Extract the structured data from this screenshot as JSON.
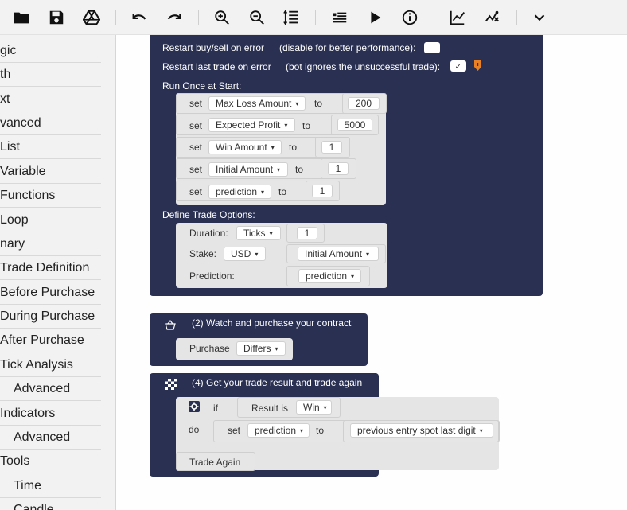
{
  "toolbar": {
    "icons": [
      "folder-open-icon",
      "save-icon",
      "google-drive-icon",
      "undo-icon",
      "redo-icon",
      "zoom-in-icon",
      "zoom-out-icon",
      "sort-icon",
      "list-icon",
      "play-icon",
      "info-icon",
      "chart-icon",
      "trading-view-icon",
      "chevron-down-icon"
    ]
  },
  "sidebar": {
    "items": [
      "gic",
      "th",
      "xt",
      "vanced",
      "List",
      "Variable",
      "Functions",
      "Loop",
      "nary",
      "Trade Definition",
      "Before Purchase",
      "During Purchase",
      "After Purchase",
      "Tick Analysis",
      "Advanced",
      "Indicators",
      "Advanced",
      "Tools",
      "Time",
      "Candle"
    ]
  },
  "trade_params": {
    "restart_on_error": "Restart buy/sell on error",
    "restart_on_error_hint": "(disable for better performance):",
    "restart_last_trade": "Restart last trade on error",
    "restart_last_trade_hint": "(bot ignores the unsuccessful trade):",
    "restart_last_trade_check": "✓",
    "run_once": "Run Once at Start:",
    "set_rows": [
      {
        "keyword": "set",
        "var": "Max Loss Amount",
        "to": "to",
        "value": "200"
      },
      {
        "keyword": "set",
        "var": "Expected Profit",
        "to": "to",
        "value": "5000"
      },
      {
        "keyword": "set",
        "var": "Win Amount",
        "to": "to",
        "value": "1"
      },
      {
        "keyword": "set",
        "var": "Initial Amount",
        "to": "to",
        "value": "1"
      },
      {
        "keyword": "set",
        "var": "prediction",
        "to": "to",
        "value": "1"
      }
    ],
    "define_options": "Define Trade Options:",
    "duration_label": "Duration:",
    "duration_unit": "Ticks",
    "duration_value": "1",
    "stake_label": "Stake:",
    "stake_currency": "USD",
    "stake_value": "Initial Amount",
    "prediction_label": "Prediction:",
    "prediction_value": "prediction"
  },
  "purchase_block": {
    "title": "(2) Watch and purchase your contract",
    "purchase_label": "Purchase",
    "purchase_value": "Differs"
  },
  "result_block": {
    "title": "(4) Get your trade result and trade again",
    "if_label": "if",
    "result_is": "Result is",
    "result_value": "Win",
    "do_label": "do",
    "set_label": "set",
    "set_var": "prediction",
    "to_label": "to",
    "set_value": "previous entry spot last digit",
    "trade_again": "Trade Again"
  },
  "colors": {
    "block_dark": "#2a3052",
    "accent_orange": "#e98024"
  }
}
